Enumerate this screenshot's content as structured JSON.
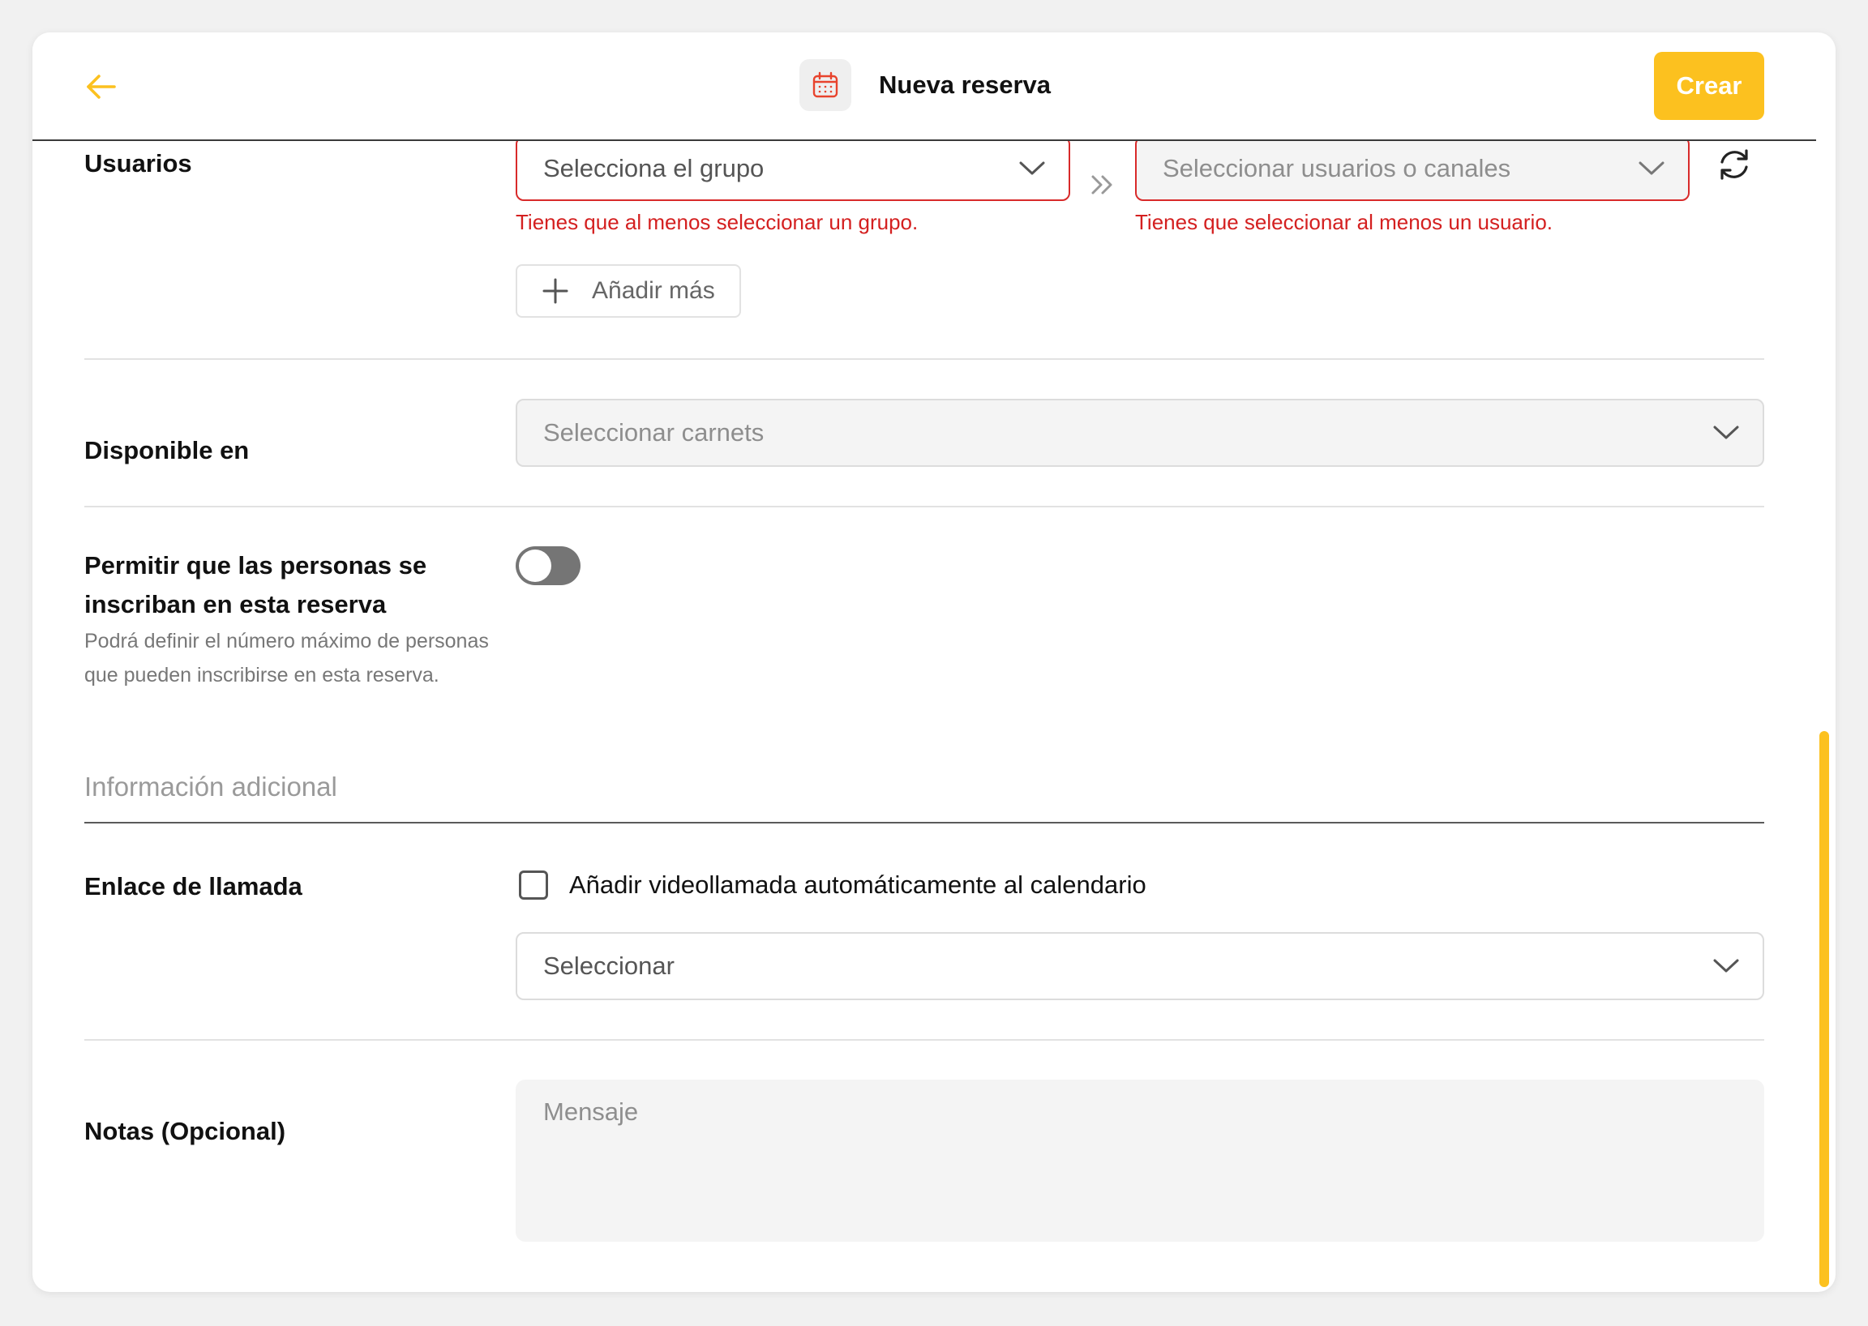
{
  "header": {
    "title": "Nueva reserva",
    "create_label": "Crear"
  },
  "usuarios": {
    "label": "Usuarios",
    "group_select_placeholder": "Selecciona el grupo",
    "group_error": "Tienes que al menos seleccionar un grupo.",
    "users_select_placeholder": "Seleccionar usuarios o canales",
    "users_error": "Tienes que seleccionar al menos un usuario.",
    "add_more_label": "Añadir más"
  },
  "disponible": {
    "label": "Disponible en",
    "select_placeholder": "Seleccionar carnets"
  },
  "inscripcion": {
    "label": "Permitir que las personas se inscriban en esta reserva",
    "description": "Podrá definir el número máximo de personas que pueden inscribirse en esta reserva.",
    "toggle_on": false
  },
  "additional": {
    "section_title": "Información adicional"
  },
  "enlace": {
    "label": "Enlace de llamada",
    "checkbox_label": "Añadir videollamada automáticamente al calendario",
    "checkbox_checked": false,
    "select_placeholder": "Seleccionar"
  },
  "notas": {
    "label": "Notas (Opcional)",
    "placeholder": "Mensaje"
  },
  "colors": {
    "accent": "#fcc11f",
    "error": "#d42020"
  }
}
